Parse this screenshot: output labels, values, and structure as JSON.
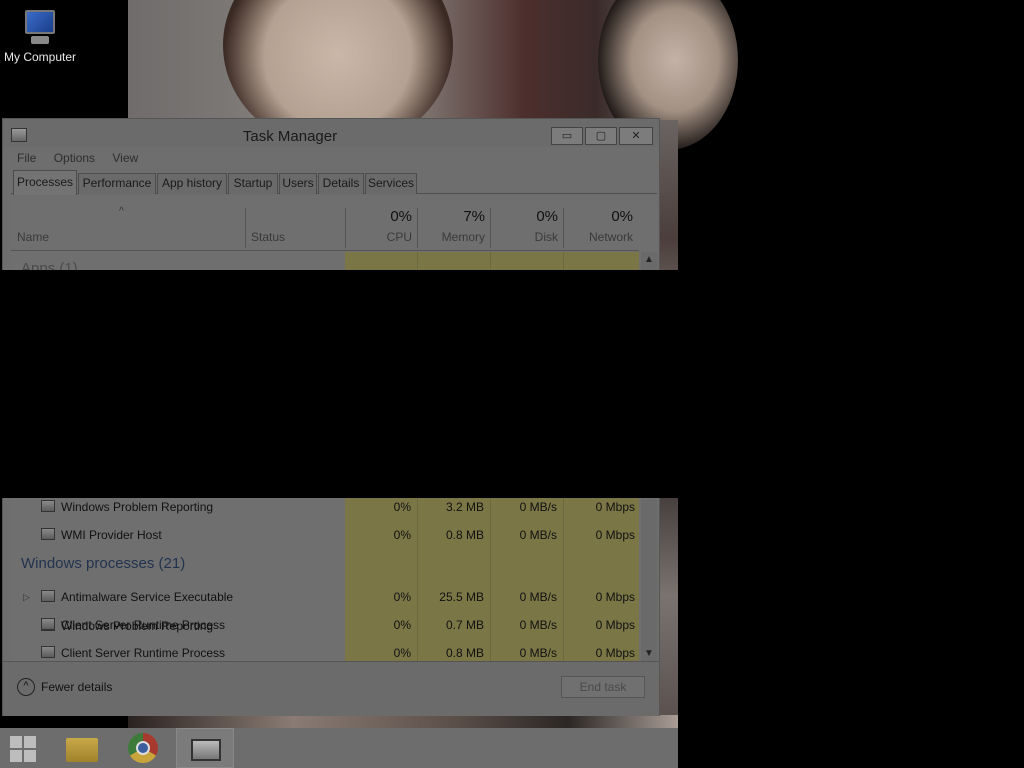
{
  "desktop": {
    "icons": [
      {
        "label": "My Computer",
        "icon": "computer-icon"
      }
    ]
  },
  "window": {
    "title": "Task Manager",
    "controls": {
      "minimize": "▭",
      "maximize": "▢",
      "close": "✕"
    }
  },
  "menu": [
    "File",
    "Options",
    "View"
  ],
  "tabs": [
    "Processes",
    "Performance",
    "App history",
    "Startup",
    "Users",
    "Details",
    "Services"
  ],
  "active_tab": "Processes",
  "columns": {
    "name": "Name",
    "status": "Status",
    "cpu": {
      "label": "CPU",
      "total": "0%"
    },
    "memory": {
      "label": "Memory",
      "total": "7%"
    },
    "disk": {
      "label": "Disk",
      "total": "0%"
    },
    "network": {
      "label": "Network",
      "total": "0%"
    }
  },
  "sort_indicator": "^",
  "groups": {
    "apps": "Apps (1)",
    "windows": "Windows processes (21)"
  },
  "rows_before": [
    {
      "name": "Windows Problem Reporting",
      "cpu": "0%",
      "memory": "3.2 MB",
      "disk": "0 MB/s",
      "network": "0 Mbps"
    },
    {
      "name": "WMI Provider Host",
      "cpu": "0%",
      "memory": "0.8 MB",
      "disk": "0 MB/s",
      "network": "0 Mbps"
    }
  ],
  "rows_windows": [
    {
      "name": "Antimalware Service Executable",
      "cpu": "0%",
      "memory": "25.5 MB",
      "disk": "0 MB/s",
      "network": "0 Mbps",
      "expandable": "▷"
    },
    {
      "name": "Client Server Runtime Process",
      "cpu": "0%",
      "memory": "0.7 MB",
      "disk": "0 MB/s",
      "network": "0 Mbps"
    },
    {
      "name": "Client Server Runtime Process",
      "cpu": "0%",
      "memory": "0.8 MB",
      "disk": "0 MB/s",
      "network": "0 Mbps"
    }
  ],
  "footer": {
    "fewer_details": "Fewer details",
    "fewer_icon": "^",
    "end_task": "End task"
  },
  "scrollbar": {
    "up": "▲",
    "down": "▼"
  },
  "taskbar": {
    "items": [
      "start-icon",
      "file-explorer-icon",
      "chrome-icon",
      "task-manager-icon"
    ]
  }
}
